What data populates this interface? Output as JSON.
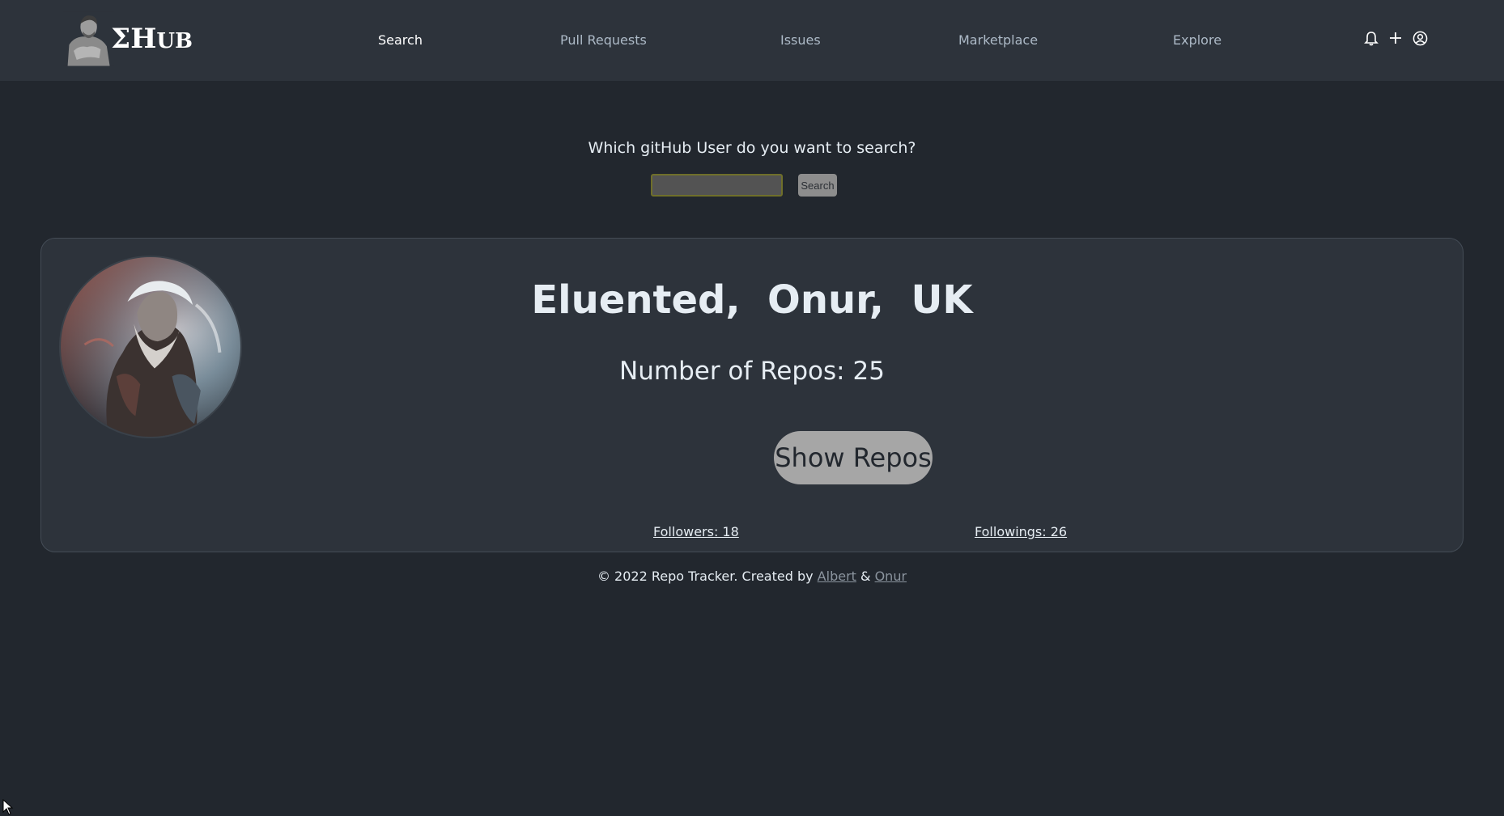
{
  "header": {
    "logo": {
      "sigma": "Σ",
      "text_big": "H",
      "text_small": "UB"
    },
    "nav": [
      {
        "label": "Search",
        "active": true
      },
      {
        "label": "Pull Requests",
        "active": false
      },
      {
        "label": "Issues",
        "active": false
      },
      {
        "label": "Marketplace",
        "active": false
      },
      {
        "label": "Explore",
        "active": false
      }
    ],
    "icons": [
      "bell-icon",
      "plus-icon",
      "user-circle-icon"
    ]
  },
  "search": {
    "question": "Which gitHub User do you want to search?",
    "input_value": "",
    "input_placeholder": "",
    "button_label": "Search"
  },
  "profile": {
    "title": "Eluented,  Onur,  UK",
    "repos_text": "Number of Repos: 25",
    "show_repos_label": "Show Repos",
    "followers_text": "Followers: 18",
    "followings_text": "Followings: 26"
  },
  "footer": {
    "prefix": "© 2022 Repo Tracker. Created by ",
    "author1": "Albert",
    "separator": " & ",
    "author2": "Onur"
  },
  "colors": {
    "page_bg": "#22272e",
    "header_bg": "#2d333b",
    "card_bg": "#2d333b",
    "button_gray": "#a6a6a6"
  }
}
